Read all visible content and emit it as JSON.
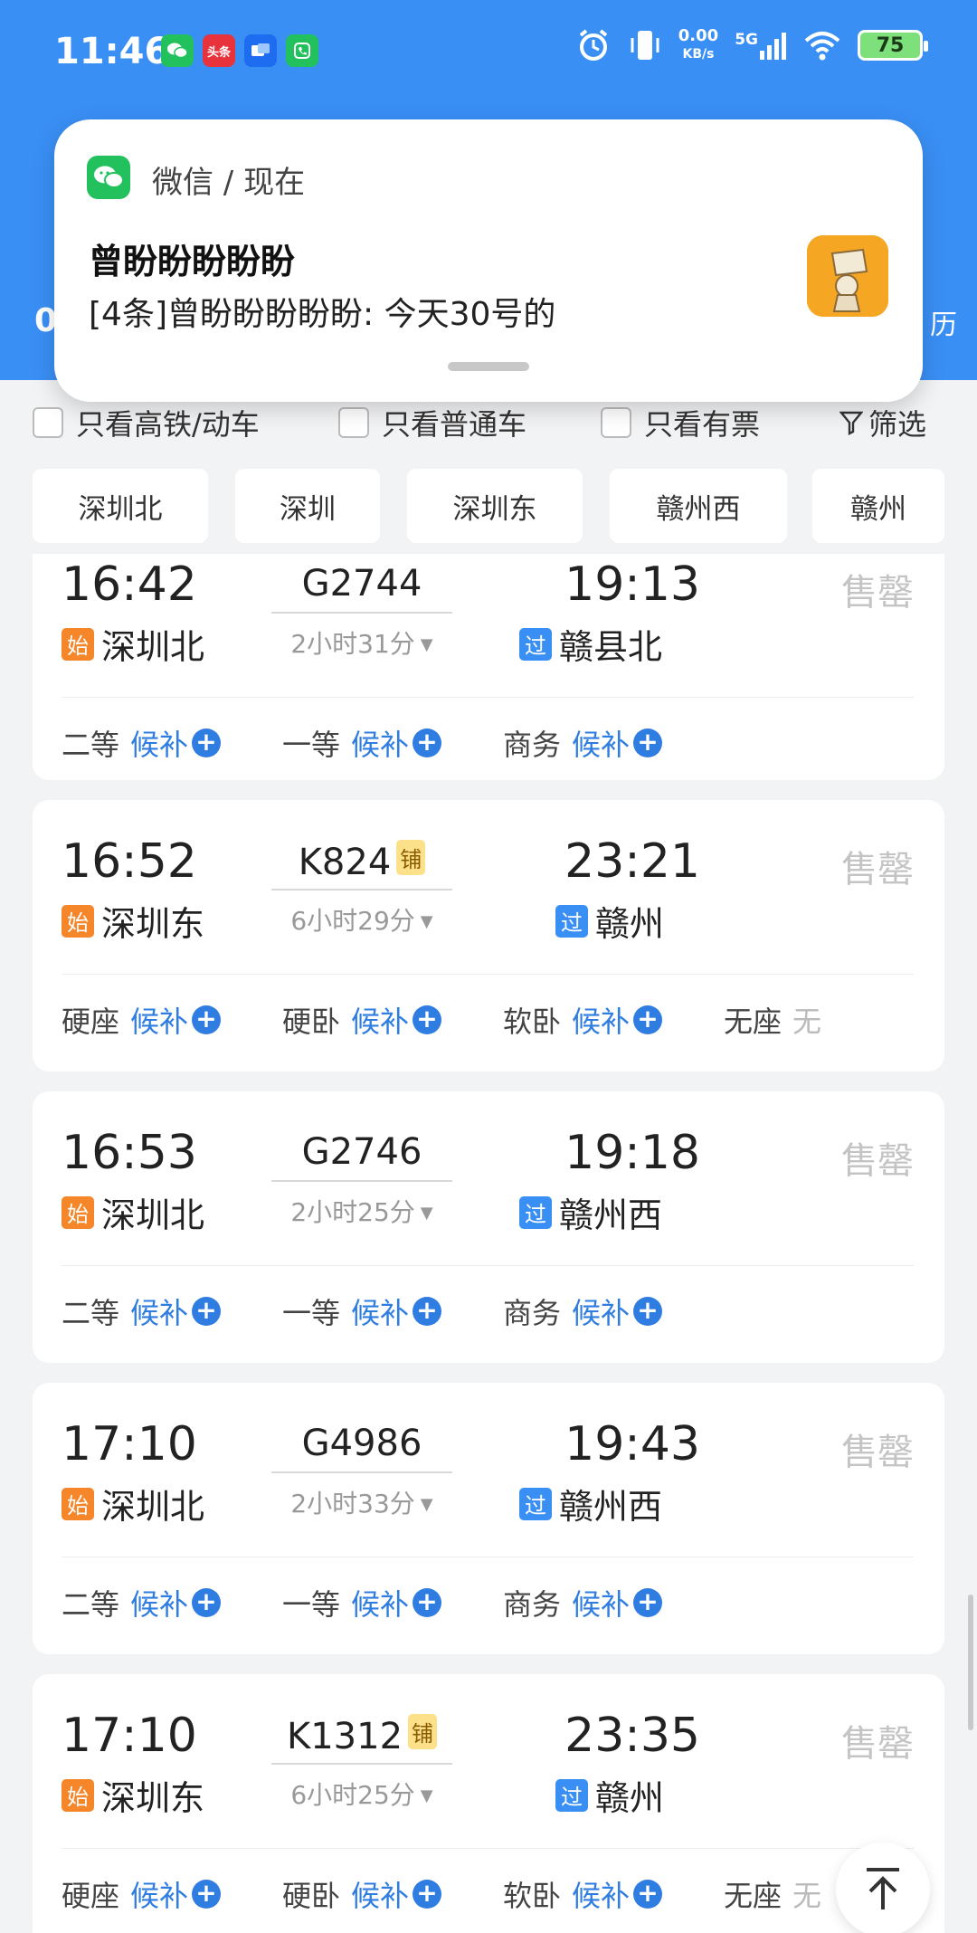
{
  "status_bar": {
    "time": "11:46",
    "net_speed_value": "0.00",
    "net_speed_unit": "KB/s",
    "network": "5G",
    "battery": "75",
    "app_badge_toutiao": "头条"
  },
  "header_peek": {
    "left_text": "0",
    "right_text": "历"
  },
  "notification": {
    "source": "微信 / 现在",
    "sender": "曾盼盼盼盼盼",
    "message": "[4条]曾盼盼盼盼盼: 今天30号的"
  },
  "filters": {
    "only_highspeed": "只看高铁/动车",
    "only_normal": "只看普通车",
    "only_available": "只看有票",
    "filter_label": "筛选"
  },
  "station_chips": [
    "深圳北",
    "深圳",
    "深圳东",
    "赣州西",
    "赣州"
  ],
  "labels": {
    "sold_out": "售罄",
    "waitlist": "候补"
  },
  "trains": [
    {
      "depart": "16:42",
      "train_no": "G2744",
      "tag": "",
      "duration": "2小时31分",
      "arrive": "19:13",
      "from_badge": "始",
      "from": "深圳北",
      "to_badge": "过",
      "to": "赣县北",
      "seats": [
        {
          "name": "二等",
          "status": "候补"
        },
        {
          "name": "一等",
          "status": "候补"
        },
        {
          "name": "商务",
          "status": "候补"
        }
      ]
    },
    {
      "depart": "16:52",
      "train_no": "K824",
      "tag": "铺",
      "duration": "6小时29分",
      "arrive": "23:21",
      "from_badge": "始",
      "from": "深圳东",
      "to_badge": "过",
      "to": "赣州",
      "seats": [
        {
          "name": "硬座",
          "status": "候补"
        },
        {
          "name": "硬卧",
          "status": "候补"
        },
        {
          "name": "软卧",
          "status": "候补"
        },
        {
          "name": "无座",
          "status": "无"
        }
      ]
    },
    {
      "depart": "16:53",
      "train_no": "G2746",
      "tag": "",
      "duration": "2小时25分",
      "arrive": "19:18",
      "from_badge": "始",
      "from": "深圳北",
      "to_badge": "过",
      "to": "赣州西",
      "seats": [
        {
          "name": "二等",
          "status": "候补"
        },
        {
          "name": "一等",
          "status": "候补"
        },
        {
          "name": "商务",
          "status": "候补"
        }
      ]
    },
    {
      "depart": "17:10",
      "train_no": "G4986",
      "tag": "",
      "duration": "2小时33分",
      "arrive": "19:43",
      "from_badge": "始",
      "from": "深圳北",
      "to_badge": "过",
      "to": "赣州西",
      "seats": [
        {
          "name": "二等",
          "status": "候补"
        },
        {
          "name": "一等",
          "status": "候补"
        },
        {
          "name": "商务",
          "status": "候补"
        }
      ]
    },
    {
      "depart": "17:10",
      "train_no": "K1312",
      "tag": "铺",
      "duration": "6小时25分",
      "arrive": "23:35",
      "from_badge": "始",
      "from": "深圳东",
      "to_badge": "过",
      "to": "赣州",
      "seats": [
        {
          "name": "硬座",
          "status": "候补"
        },
        {
          "name": "硬卧",
          "status": "候补"
        },
        {
          "name": "软卧",
          "status": "候补"
        },
        {
          "name": "无座",
          "status": "无"
        }
      ]
    }
  ]
}
